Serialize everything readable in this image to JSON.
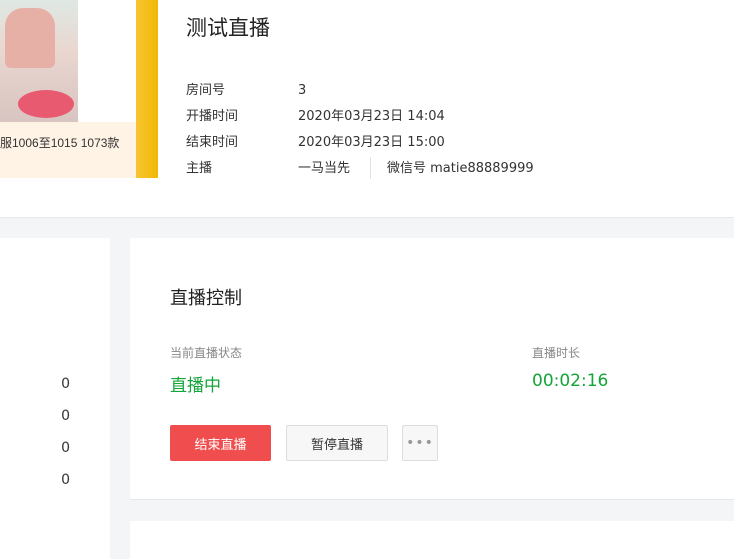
{
  "cover": {
    "caption": "服1006至1015 1073款"
  },
  "room": {
    "title": "测试直播",
    "rows": [
      {
        "label": "房间号",
        "value": "3"
      },
      {
        "label": "开播时间",
        "value": "2020年03月23日 14:04"
      },
      {
        "label": "结束时间",
        "value": "2020年03月23日 15:00"
      },
      {
        "label": "主播",
        "value": "一马当先"
      }
    ],
    "wechat": "微信号 matie88889999"
  },
  "left_stats": [
    "0",
    "0",
    "0",
    "0"
  ],
  "control": {
    "title": "直播控制",
    "status_label": "当前直播状态",
    "status_value": "直播中",
    "duration_label": "直播时长",
    "duration_value": "00:02:16",
    "end_button": "结束直播",
    "pause_button": "暂停直播",
    "more_button": "•••",
    "accent_color": "#13a538",
    "danger_color": "#f04e4e"
  }
}
